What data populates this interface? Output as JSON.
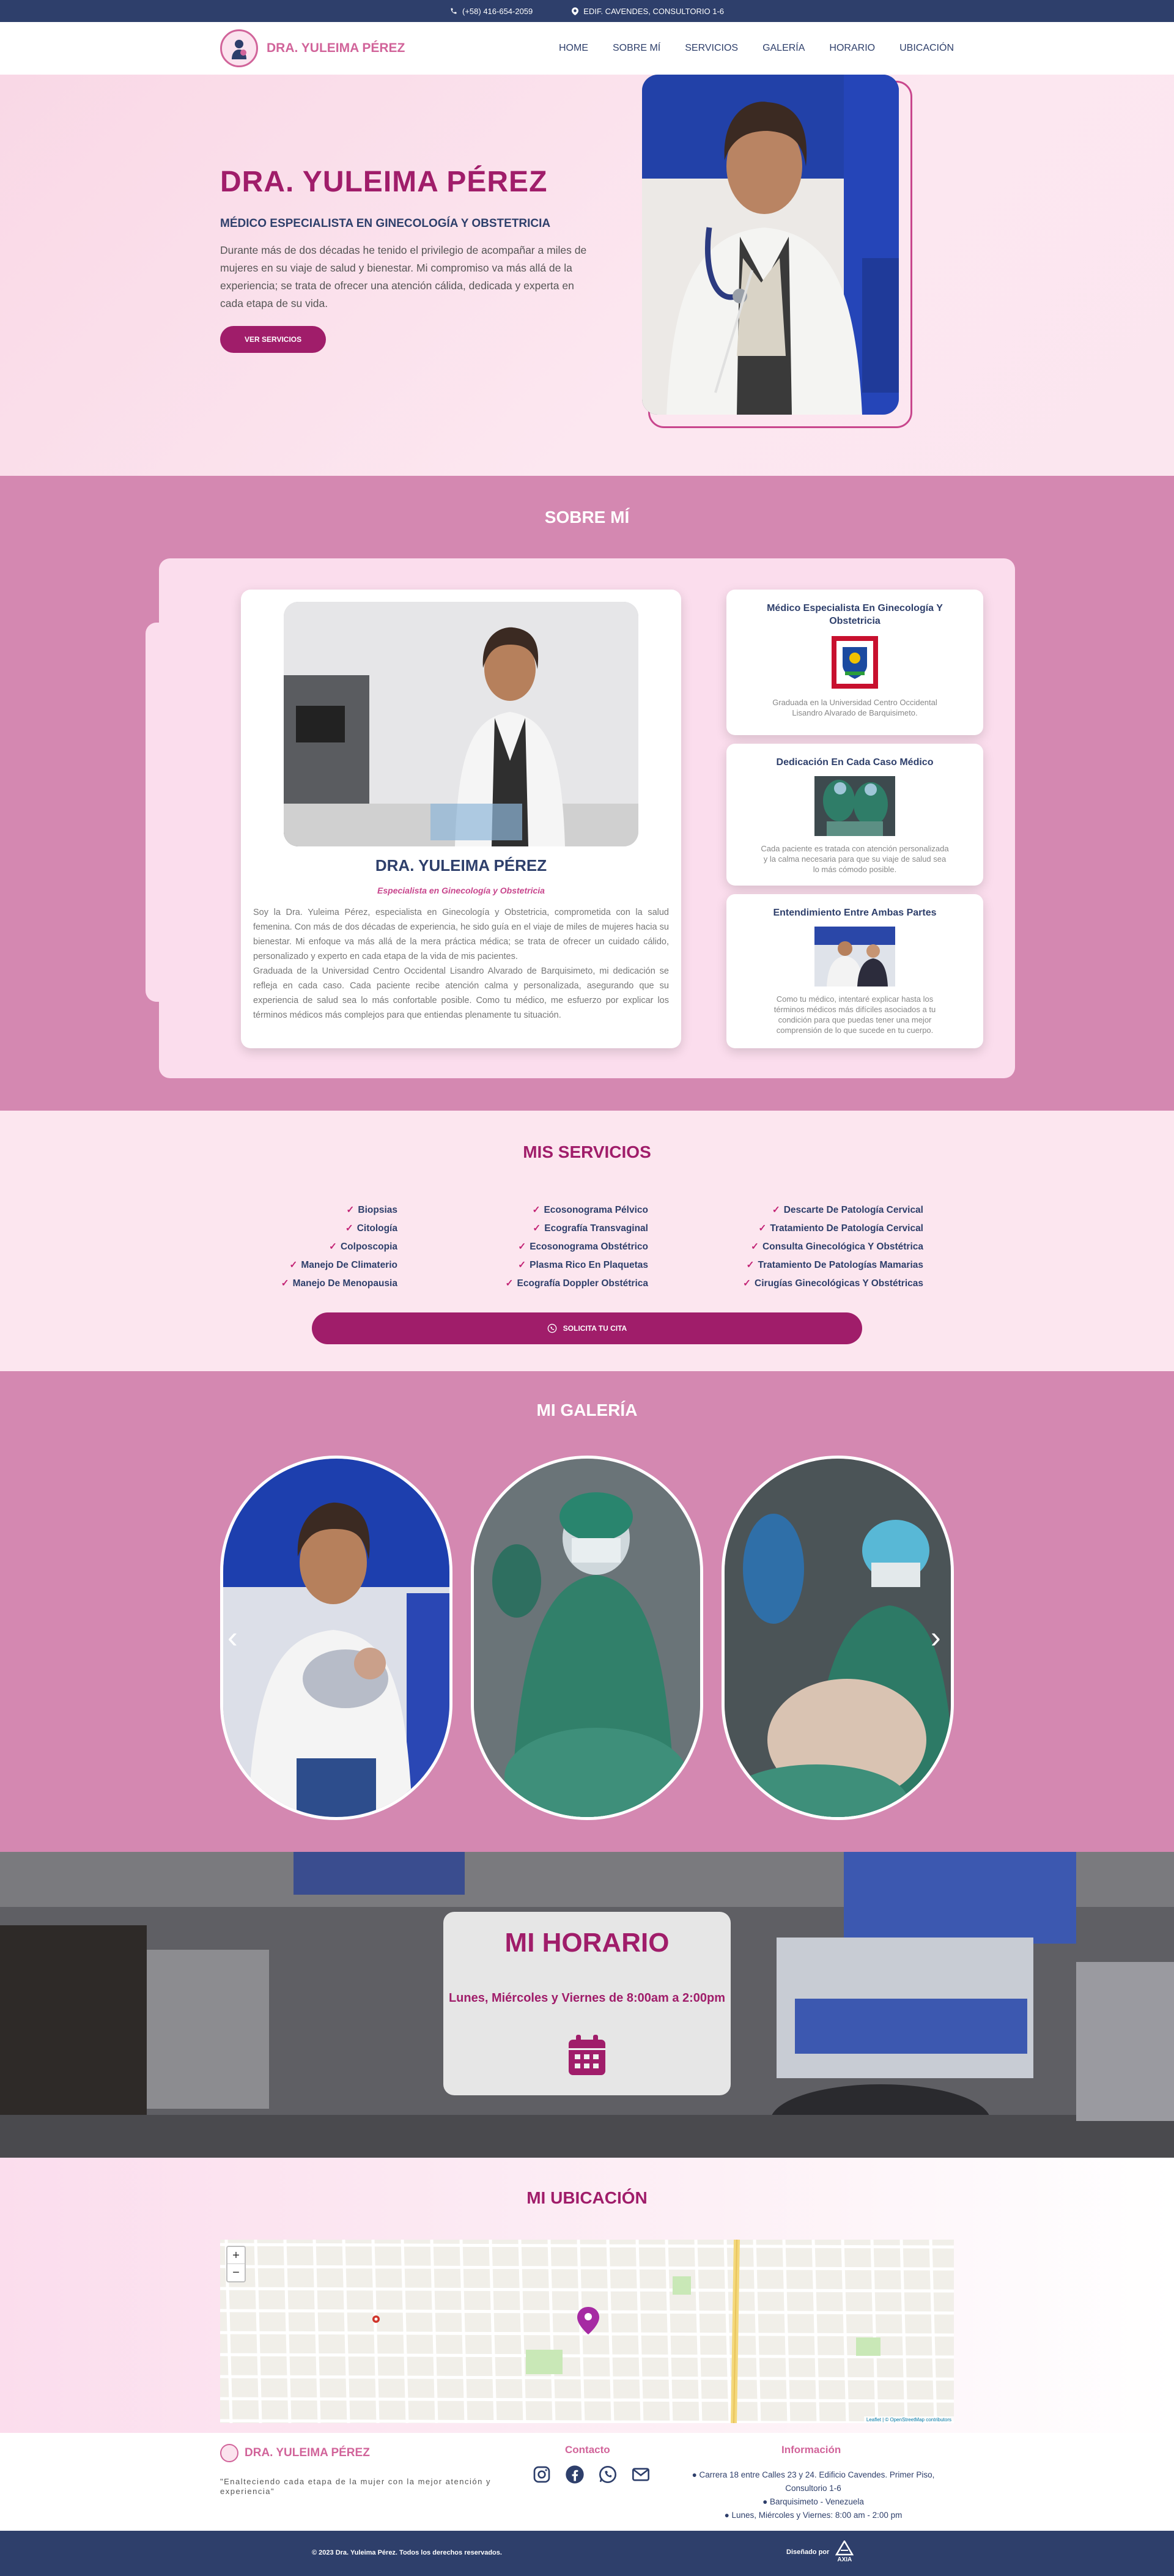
{
  "topbar": {
    "phone": "(+58) 416-654-2059",
    "address": "EDIF. CAVENDES, CONSULTORIO 1-6"
  },
  "header": {
    "brand": "DRA. YULEIMA PÉREZ",
    "nav": [
      "HOME",
      "SOBRE MÍ",
      "SERVICIOS",
      "GALERÍA",
      "HORARIO",
      "UBICACIÓN"
    ]
  },
  "hero": {
    "title": "DRA. YULEIMA PÉREZ",
    "subtitle": "MÉDICO ESPECIALISTA EN GINECOLOGÍA Y OBSTETRICIA",
    "description": "Durante más de dos décadas he tenido el privilegio de acompañar a miles de mujeres en su viaje de salud y bienestar. Mi compromiso va más allá de la experiencia; se trata de ofrecer una atención cálida, dedicada y experta en cada etapa de su vida.",
    "button": "VER SERVICIOS"
  },
  "sobre": {
    "title": "SOBRE MÍ",
    "name": "DRA. YULEIMA PÉREZ",
    "specialty": "Especialista en Ginecología y Obstetricia",
    "bio": "Soy la Dra. Yuleima Pérez, especialista en Ginecología y Obstetricia, comprometida con la salud femenina. Con más de dos décadas de experiencia, he sido guía en el viaje de miles de mujeres hacia su bienestar. Mi enfoque va más allá de la mera práctica médica; se trata de ofrecer un cuidado cálido, personalizado y experto en cada etapa de la vida de mis pacientes.",
    "bio2": "Graduada de la Universidad Centro Occidental Lisandro Alvarado de Barquisimeto, mi dedicación se refleja en cada caso. Cada paciente recibe atención calma y personalizada, asegurando que su experiencia de salud sea lo más confortable posible. Como tu médico, me esfuerzo por explicar los términos médicos más complejos para que entiendas plenamente tu situación.",
    "features": [
      {
        "title": "Médico Especialista En Ginecología Y Obstetricia",
        "text": "Graduada en la Universidad Centro Occidental Lisandro Alvarado de Barquisimeto."
      },
      {
        "title": "Dedicación En Cada Caso Médico",
        "text": "Cada paciente es tratada con atención personalizada y la calma necesaria para que su viaje de salud sea lo más cómodo posible."
      },
      {
        "title": "Entendimiento Entre Ambas Partes",
        "text": "Como tu médico, intentaré explicar hasta los términos médicos más difíciles asociados a tu condición para que puedas tener una mejor comprensión de lo que sucede en tu cuerpo."
      }
    ]
  },
  "servicios": {
    "title": "MIS SERVICIOS",
    "col1": [
      "Biopsias",
      "Citología",
      "Colposcopia",
      "Manejo De Climaterio",
      "Manejo De Menopausia"
    ],
    "col2": [
      "Ecosonograma Pélvico",
      "Ecografía Transvaginal",
      "Ecosonograma Obstétrico",
      "Plasma Rico En Plaquetas",
      "Ecografía Doppler Obstétrica"
    ],
    "col3": [
      "Descarte De Patología Cervical",
      "Tratamiento De Patología Cervical",
      "Consulta Ginecológica Y Obstétrica",
      "Tratamiento De Patologías Mamarias",
      "Cirugías Ginecológicas Y Obstétricas"
    ],
    "button": "SOLICITA TU CITA"
  },
  "galeria": {
    "title": "MI GALERÍA",
    "prev": "‹",
    "next": "›"
  },
  "horario": {
    "title": "MI HORARIO",
    "days": "Lunes, Miércoles y Viernes de 8:00am a 2:00pm"
  },
  "ubicacion": {
    "title": "MI UBICACIÓN",
    "zoom_in": "+",
    "zoom_out": "−",
    "attribution": "Leaflet | © OpenStreetMap contributors"
  },
  "footer": {
    "brand": "DRA. YULEIMA PÉREZ",
    "slogan": "\"Enalteciendo cada etapa de la mujer con la mejor atención y experiencia\"",
    "contact_title": "Contacto",
    "info_title": "Información",
    "info_address": "Carrera 18 entre Calles 23 y 24. Edificio Cavendes. Primer Piso, Consultorio 1-6",
    "info_city": "Barquisimeto - Venezuela",
    "info_hours": "Lunes, Miércoles y Viernes: 8:00 am - 2:00 pm",
    "copyright": "© 2023 Dra. Yuleima Pérez. Todos los derechos reservados.",
    "designed_by": "Diseñado por",
    "designer": "AXIA"
  },
  "colors": {
    "navy": "#2e3f6b",
    "magenta": "#a01d6a",
    "pink": "#d488b1",
    "light_pink": "#fce6ef"
  }
}
